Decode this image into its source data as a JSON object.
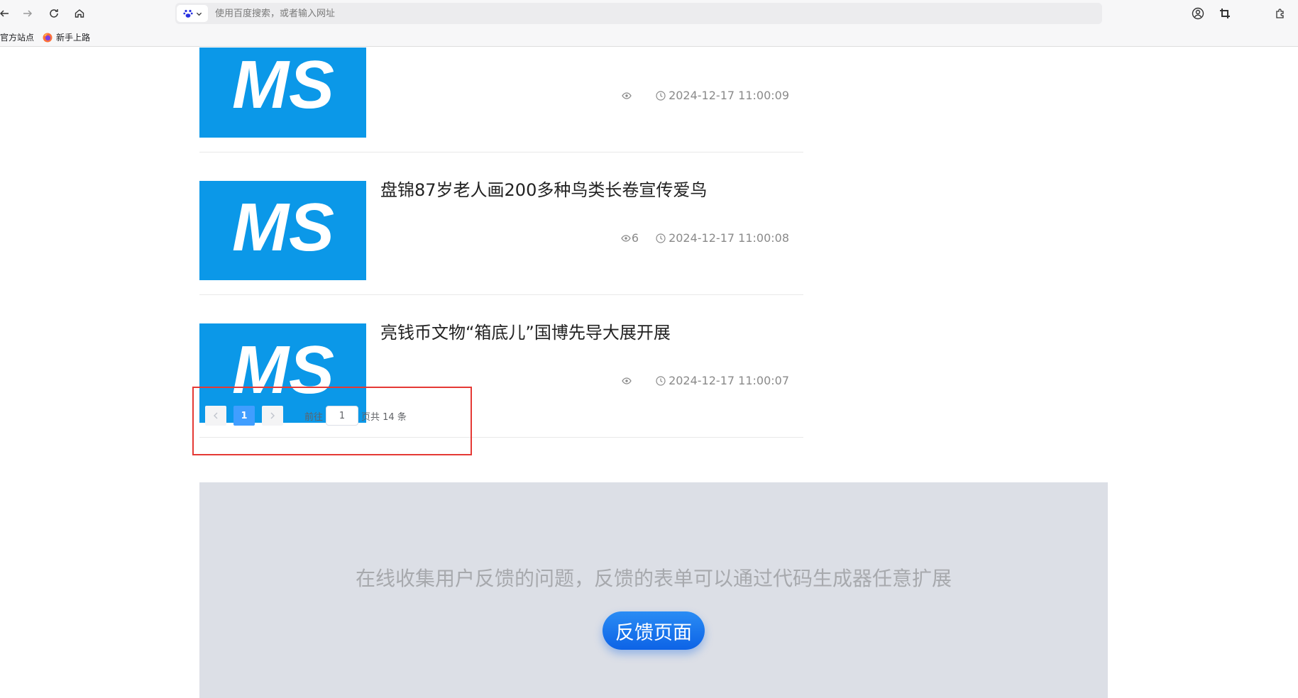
{
  "browser": {
    "address_placeholder": "使用百度搜索，或者输入网址",
    "bookmarks": [
      "官方站点",
      "新手上路"
    ]
  },
  "news": [
    {
      "title": "",
      "views": "",
      "date": "2024-12-17 11:00:09"
    },
    {
      "title": "盘锦87岁老人画200多种鸟类长卷宣传爱鸟",
      "views": "6",
      "date": "2024-12-17 11:00:08"
    },
    {
      "title": "亮钱币文物“箱底儿”国博先导大展开展",
      "views": "",
      "date": "2024-12-17 11:00:07"
    }
  ],
  "thumbnail_logo": "MS",
  "pagination": {
    "current_page": "1",
    "goto_label": "前往",
    "goto_value": "1",
    "page_suffix": "页",
    "total_label": "共 14 条"
  },
  "feedback": {
    "description": "在线收集用户反馈的问题，反馈的表单可以通过代码生成器任意扩展",
    "button_label": "反馈页面"
  },
  "colors": {
    "thumbnail_bg": "#0b98e8",
    "pagination_active": "#409eff",
    "highlight_border": "#e53935",
    "feedback_bg": "#dcdfe6",
    "feedback_button": "#0d63e6"
  }
}
